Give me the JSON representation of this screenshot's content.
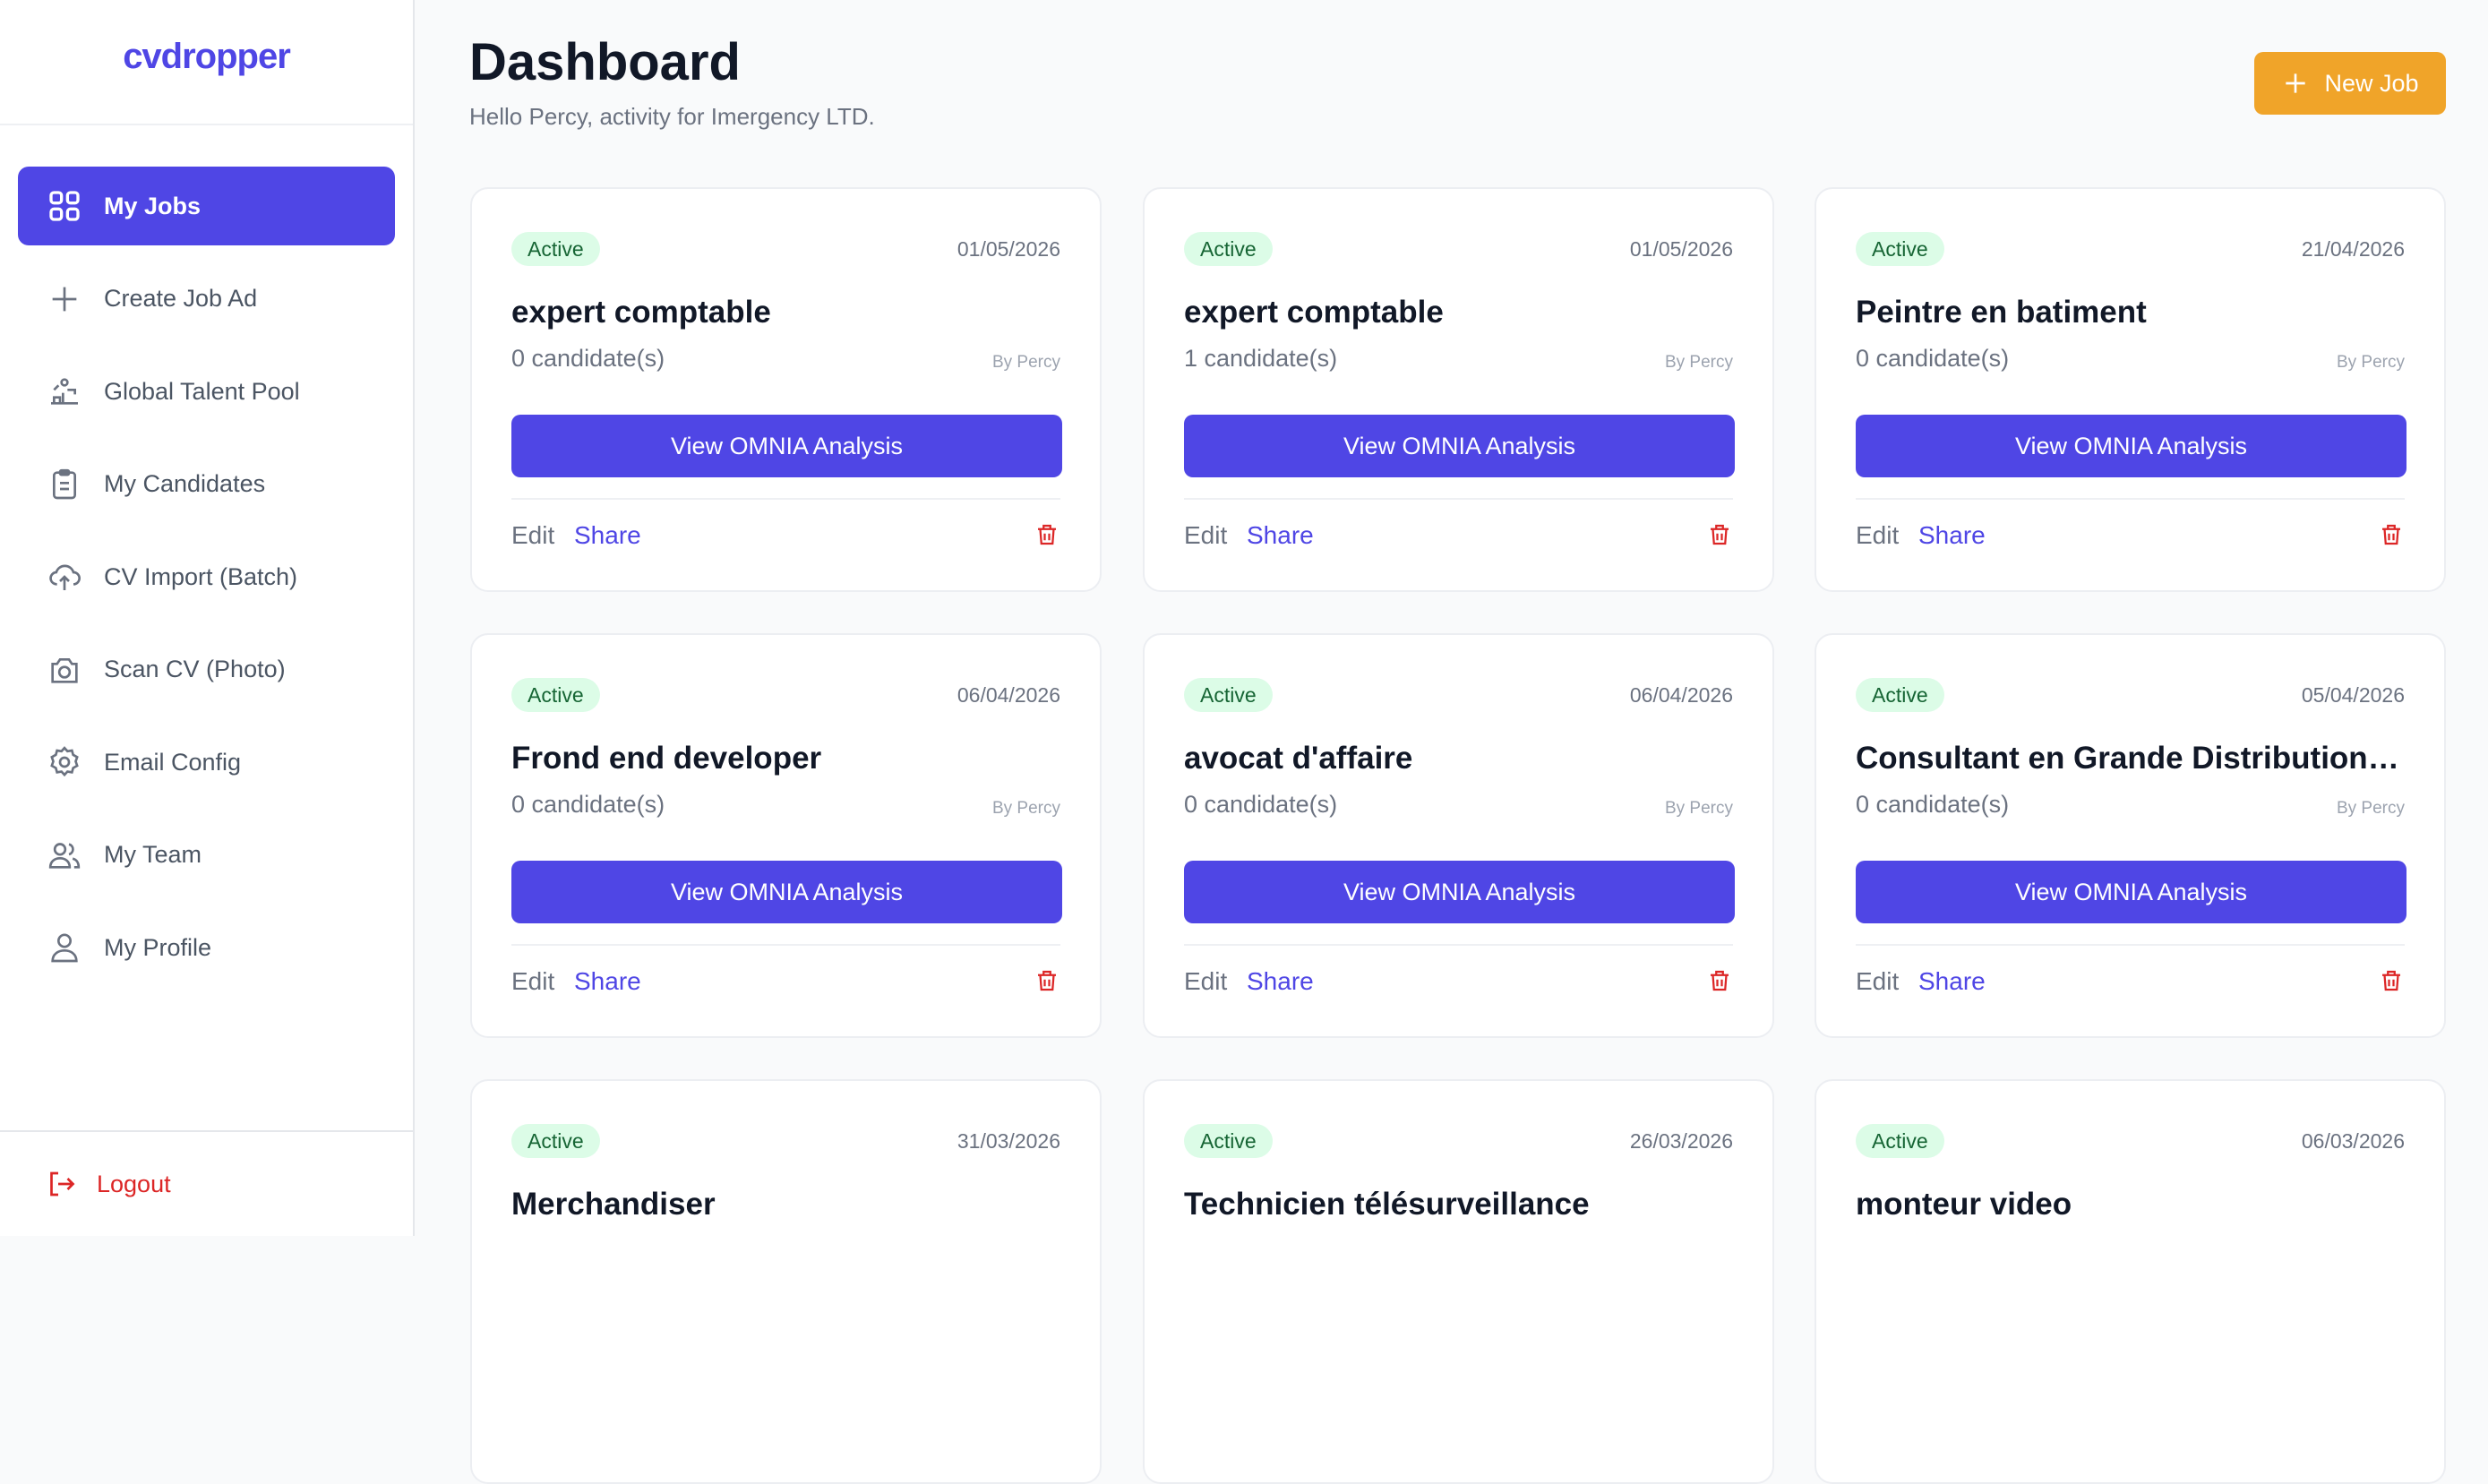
{
  "app": {
    "logo": "cvdropper"
  },
  "sidebar": {
    "items": [
      {
        "label": "My Jobs",
        "icon": "grid-icon",
        "active": true
      },
      {
        "label": "Create Job Ad",
        "icon": "plus-icon"
      },
      {
        "label": "Global Talent Pool",
        "icon": "talent-pool-icon"
      },
      {
        "label": "My Candidates",
        "icon": "clipboard-icon"
      },
      {
        "label": "CV Import (Batch)",
        "icon": "cloud-upload-icon"
      },
      {
        "label": "Scan CV (Photo)",
        "icon": "camera-icon"
      },
      {
        "label": "Email Config",
        "icon": "gear-icon"
      },
      {
        "label": "My Team",
        "icon": "team-icon"
      },
      {
        "label": "My Profile",
        "icon": "user-icon"
      }
    ],
    "logout": "Logout"
  },
  "header": {
    "title": "Dashboard",
    "subtitle": "Hello Percy, activity for Imergency LTD.",
    "new_job": "New Job"
  },
  "card_labels": {
    "view_button": "View OMNIA Analysis",
    "edit": "Edit",
    "share": "Share"
  },
  "jobs": [
    {
      "status": "Active",
      "date": "01/05/2026",
      "title": "expert comptable",
      "candidates": "0 candidate(s)",
      "by": "By Percy"
    },
    {
      "status": "Active",
      "date": "01/05/2026",
      "title": "expert comptable",
      "candidates": "1 candidate(s)",
      "by": "By Percy"
    },
    {
      "status": "Active",
      "date": "21/04/2026",
      "title": "Peintre en batiment",
      "candidates": "0 candidate(s)",
      "by": "By Percy"
    },
    {
      "status": "Active",
      "date": "06/04/2026",
      "title": "Frond end developer",
      "candidates": "0 candidate(s)",
      "by": "By Percy"
    },
    {
      "status": "Active",
      "date": "06/04/2026",
      "title": "avocat d'affaire",
      "candidates": "0 candidate(s)",
      "by": "By Percy"
    },
    {
      "status": "Active",
      "date": "05/04/2026",
      "title": "Consultant en Grande Distribution (...",
      "candidates": "0 candidate(s)",
      "by": "By Percy"
    },
    {
      "status": "Active",
      "date": "31/03/2026",
      "title": "Merchandiser",
      "candidates": "",
      "by": ""
    },
    {
      "status": "Active",
      "date": "26/03/2026",
      "title": "Technicien télésurveillance",
      "candidates": "",
      "by": ""
    },
    {
      "status": "Active",
      "date": "06/03/2026",
      "title": "monteur video",
      "candidates": "",
      "by": ""
    }
  ],
  "colors": {
    "accent": "#4f46e5",
    "new_job": "#f0a429",
    "badge_bg": "#dcfce7",
    "badge_text": "#166534",
    "danger": "#dc2626"
  }
}
